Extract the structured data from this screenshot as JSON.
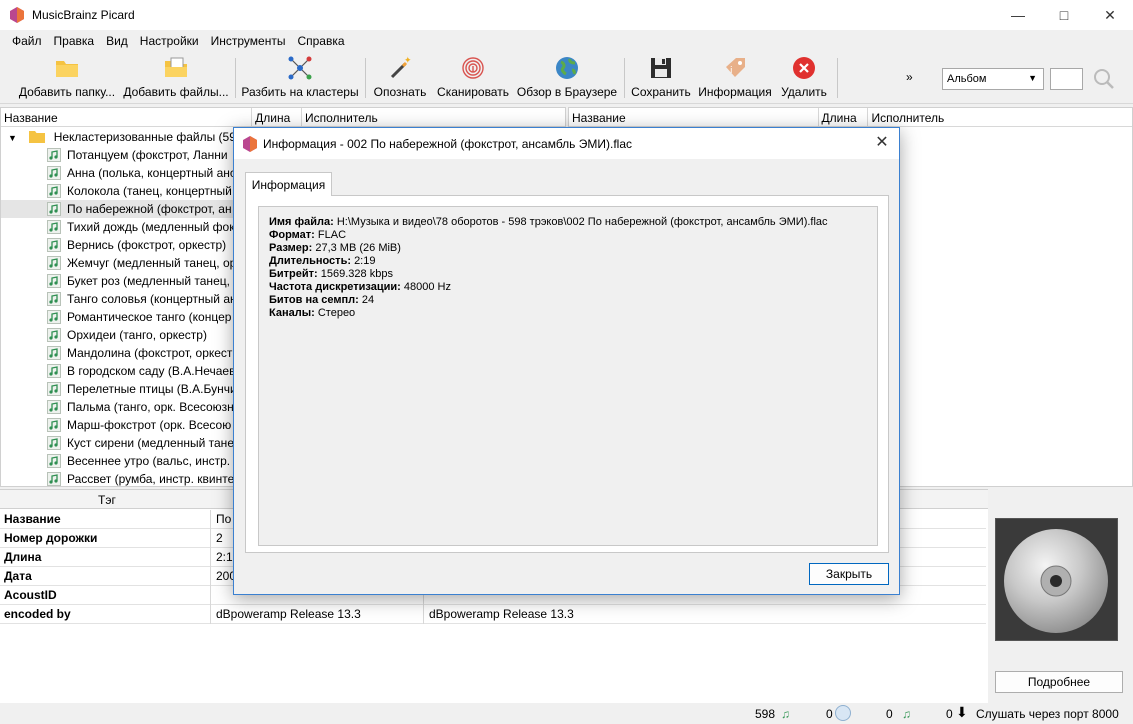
{
  "window": {
    "title": "MusicBrainz Picard"
  },
  "menu": [
    "Файл",
    "Правка",
    "Вид",
    "Настройки",
    "Инструменты",
    "Справка"
  ],
  "toolbar": {
    "add_folder": "Добавить папку...",
    "add_files": "Добавить файлы...",
    "cluster": "Разбить на кластеры",
    "lookup": "Опознать",
    "scan": "Сканировать",
    "browser": "Обзор в Браузере",
    "save": "Сохранить",
    "info": "Информация",
    "remove": "Удалить",
    "overflow": "»",
    "view_combo": "Альбом"
  },
  "left_pane": {
    "columns": [
      "Название",
      "Длина",
      "Исполнитель"
    ],
    "cluster_label": "Некластеризованные файлы (598)",
    "files": [
      "Потанцуем (фокстрот, Ланни",
      "Анна (полька, концертный анс",
      "Колокола (танец, концертный",
      "По набережной (фокстрот, ан",
      "Тихий дождь (медленный фок",
      "Вернись (фокстрот, оркестр)",
      "Жемчуг (медленный танец, ор",
      "Букет роз (медленный танец, с",
      "Танго соловья (концертный ан",
      "Романтическое танго (концер",
      "Орхидеи (танго, оркестр)",
      "Мандолина (фокстрот, оркест",
      "В городском саду (В.А.Нечаев",
      "Перелетные птицы (В.А.Бунчи",
      "Пальма (танго, орк. Всесоюзн",
      "Марш-фокстрот (орк. Всесою",
      "Куст сирени (медленный тане",
      "Весеннее утро (вальс, инстр. к",
      "Рассвет (румба, инстр. квинте"
    ],
    "selected_index": 3
  },
  "right_pane": {
    "columns": [
      "Название",
      "Длина",
      "Исполнитель"
    ]
  },
  "tags": {
    "header": "Тэг",
    "rows": [
      {
        "name": "Название",
        "orig": "По",
        "new": ""
      },
      {
        "name": "Номер дорожки",
        "orig": "2",
        "new": ""
      },
      {
        "name": "Длина",
        "orig": "2:19",
        "new": ""
      },
      {
        "name": "Дата",
        "orig": "200",
        "new": ""
      },
      {
        "name": "AcoustID",
        "orig": "",
        "new": ""
      },
      {
        "name": "encoded by",
        "orig": "dBpoweramp Release 13.3",
        "new": "dBpoweramp Release 13.3"
      }
    ]
  },
  "more_button": "Подробнее",
  "status": {
    "files_count": "598",
    "pending_1": "0",
    "pending_2": "0",
    "pending_3": "0",
    "port_text": "Слушать через порт 8000"
  },
  "dialog": {
    "title": "Информация - 002 По набережной (фокстрот, ансамбль ЭМИ).flac",
    "tab": "Информация",
    "lines": [
      {
        "label": "Имя файла:",
        "value": "H:\\Музыка и видео\\78 оборотов - 598 трэков\\002 По набережной (фокстрот, ансамбль ЭМИ).flac"
      },
      {
        "label": "Формат:",
        "value": "FLAC"
      },
      {
        "label": "Размер:",
        "value": "27,3 MB (26 MiB)"
      },
      {
        "label": "Длительность:",
        "value": "2:19"
      },
      {
        "label": "Битрейт:",
        "value": "1569.328 kbps"
      },
      {
        "label": "Частота дискретизации:",
        "value": "48000 Hz"
      },
      {
        "label": "Битов на семпл:",
        "value": "24"
      },
      {
        "label": "Каналы:",
        "value": "Стерео"
      }
    ],
    "close_button": "Закрыть"
  }
}
